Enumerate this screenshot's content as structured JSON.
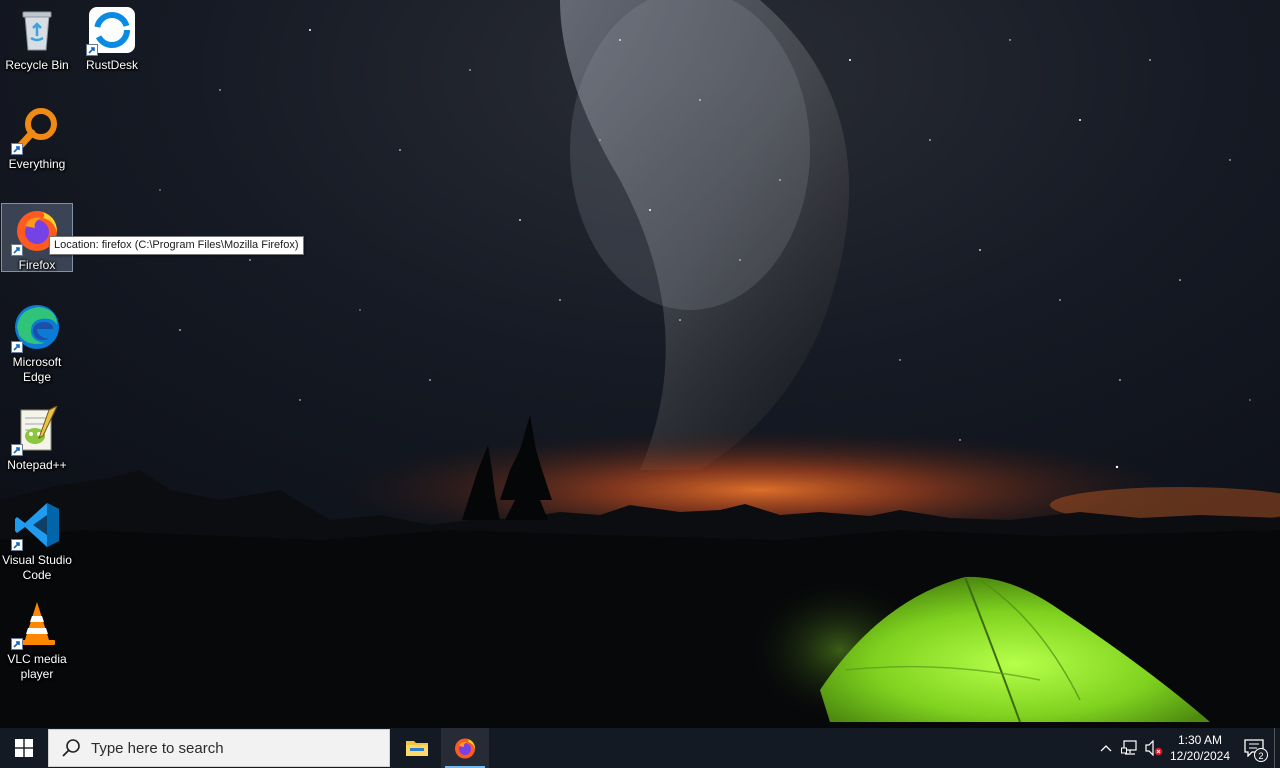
{
  "desktop": {
    "icons": [
      {
        "label": "Recycle Bin",
        "icon": "recycle-bin-icon"
      },
      {
        "label": "RustDesk",
        "icon": "rustdesk-icon"
      },
      {
        "label": "Everything",
        "icon": "everything-search-icon"
      },
      {
        "label": "Firefox",
        "icon": "firefox-icon"
      },
      {
        "label": "Microsoft Edge",
        "icon": "edge-icon"
      },
      {
        "label": "Notepad++",
        "icon": "notepadpp-icon"
      },
      {
        "label": "Visual Studio Code",
        "icon": "vscode-icon"
      },
      {
        "label": "VLC media player",
        "icon": "vlc-icon"
      }
    ],
    "tooltip": "Location: firefox (C:\\Program Files\\Mozilla Firefox)"
  },
  "taskbar": {
    "search_placeholder": "Type here to search",
    "apps": [
      {
        "name": "File Explorer",
        "icon": "file-explorer-icon"
      },
      {
        "name": "Firefox",
        "icon": "firefox-icon"
      }
    ],
    "clock": {
      "time": "1:30 AM",
      "date": "12/20/2024"
    },
    "notification_count": "2"
  },
  "colors": {
    "taskbar_bg": "#141a24",
    "accent": "#76b9ed",
    "tent": "#8ee82c"
  }
}
